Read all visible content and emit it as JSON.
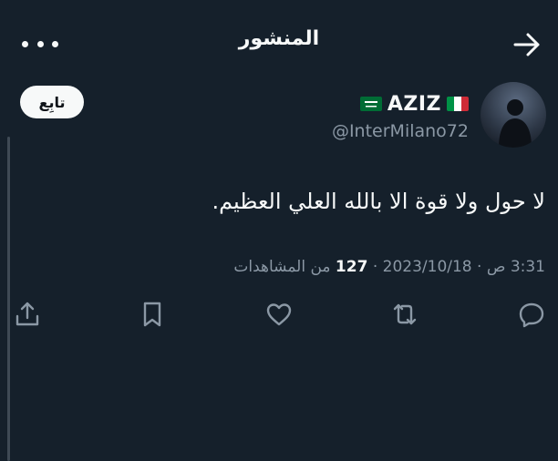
{
  "header": {
    "title": "المنشور"
  },
  "author": {
    "display_name": "AZIZ",
    "handle": "@InterMilano72",
    "follow_label": "تابِع"
  },
  "tweet": {
    "text": "لا حول ولا قوة الا بالله العلي العظيم.",
    "date": "2023/10/18",
    "time": "3:31 ص",
    "separator": "·",
    "views_count": "127",
    "views_label": "من المشاهدات"
  },
  "icons": {
    "back": "arrow-right-icon",
    "more": "more-horizontal-icon",
    "reply": "reply-icon",
    "retweet": "retweet-icon",
    "like": "heart-icon",
    "bookmark": "bookmark-icon",
    "share": "share-icon"
  },
  "colors": {
    "background": "#15202b",
    "text": "#f7f9f9",
    "secondary_text": "#8b98a5"
  }
}
